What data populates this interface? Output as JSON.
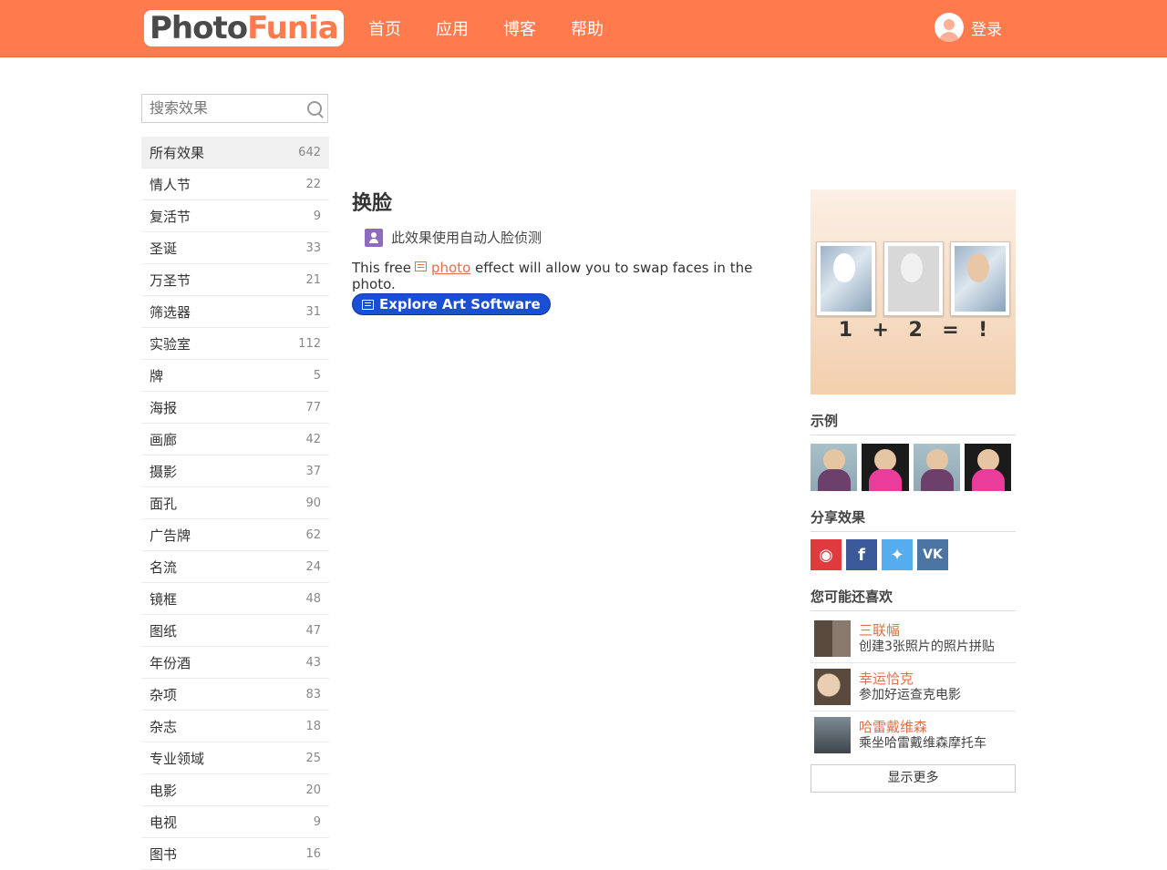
{
  "header": {
    "logo_part1": "Photo",
    "logo_part2": "Funia",
    "nav": [
      "首页",
      "应用",
      "博客",
      "帮助"
    ],
    "login_label": "登录"
  },
  "sidebar": {
    "search_placeholder": "搜索效果",
    "categories": [
      {
        "label": "所有效果",
        "count": "642"
      },
      {
        "label": "情人节",
        "count": "22"
      },
      {
        "label": "复活节",
        "count": "9"
      },
      {
        "label": "圣诞",
        "count": "33"
      },
      {
        "label": "万圣节",
        "count": "21"
      },
      {
        "label": "筛选器",
        "count": "31"
      },
      {
        "label": "实验室",
        "count": "112"
      },
      {
        "label": "牌",
        "count": "5"
      },
      {
        "label": "海报",
        "count": "77"
      },
      {
        "label": "画廊",
        "count": "42"
      },
      {
        "label": "摄影",
        "count": "37"
      },
      {
        "label": "面孔",
        "count": "90"
      },
      {
        "label": "广告牌",
        "count": "62"
      },
      {
        "label": "名流",
        "count": "24"
      },
      {
        "label": "镜框",
        "count": "48"
      },
      {
        "label": "图纸",
        "count": "47"
      },
      {
        "label": "年份酒",
        "count": "43"
      },
      {
        "label": "杂项",
        "count": "83"
      },
      {
        "label": "杂志",
        "count": "18"
      },
      {
        "label": "专业领域",
        "count": "25"
      },
      {
        "label": "电影",
        "count": "20"
      },
      {
        "label": "电视",
        "count": "9"
      },
      {
        "label": "图书",
        "count": "16"
      }
    ]
  },
  "main": {
    "title": "换脸",
    "face_detect_note": "此效果使用自动人脸侦测",
    "desc_before": "This free",
    "desc_link": "photo",
    "desc_after": "effect will allow you to swap faces in the photo.",
    "explore_button": "Explore Art Software"
  },
  "side": {
    "formula": [
      "1",
      "+",
      "2",
      "=",
      "!"
    ],
    "examples_title": "示例",
    "share_title": "分享效果",
    "shares": [
      "weibo",
      "f",
      "twitter",
      "vk"
    ],
    "vk_label": "VK",
    "fb_label": "f",
    "likes_title": "您可能还喜欢",
    "likes": [
      {
        "name": "三联幅",
        "sub": "创建3张照片的照片拼贴"
      },
      {
        "name": "幸运恰克",
        "sub": "参加好运查克电影"
      },
      {
        "name": "哈雷戴维森",
        "sub": "乘坐哈雷戴维森摩托车"
      }
    ],
    "more_button": "显示更多"
  },
  "colors": {
    "brand": "#ff7a4d",
    "link": "#e0704a",
    "explore": "#1a4fd4"
  }
}
